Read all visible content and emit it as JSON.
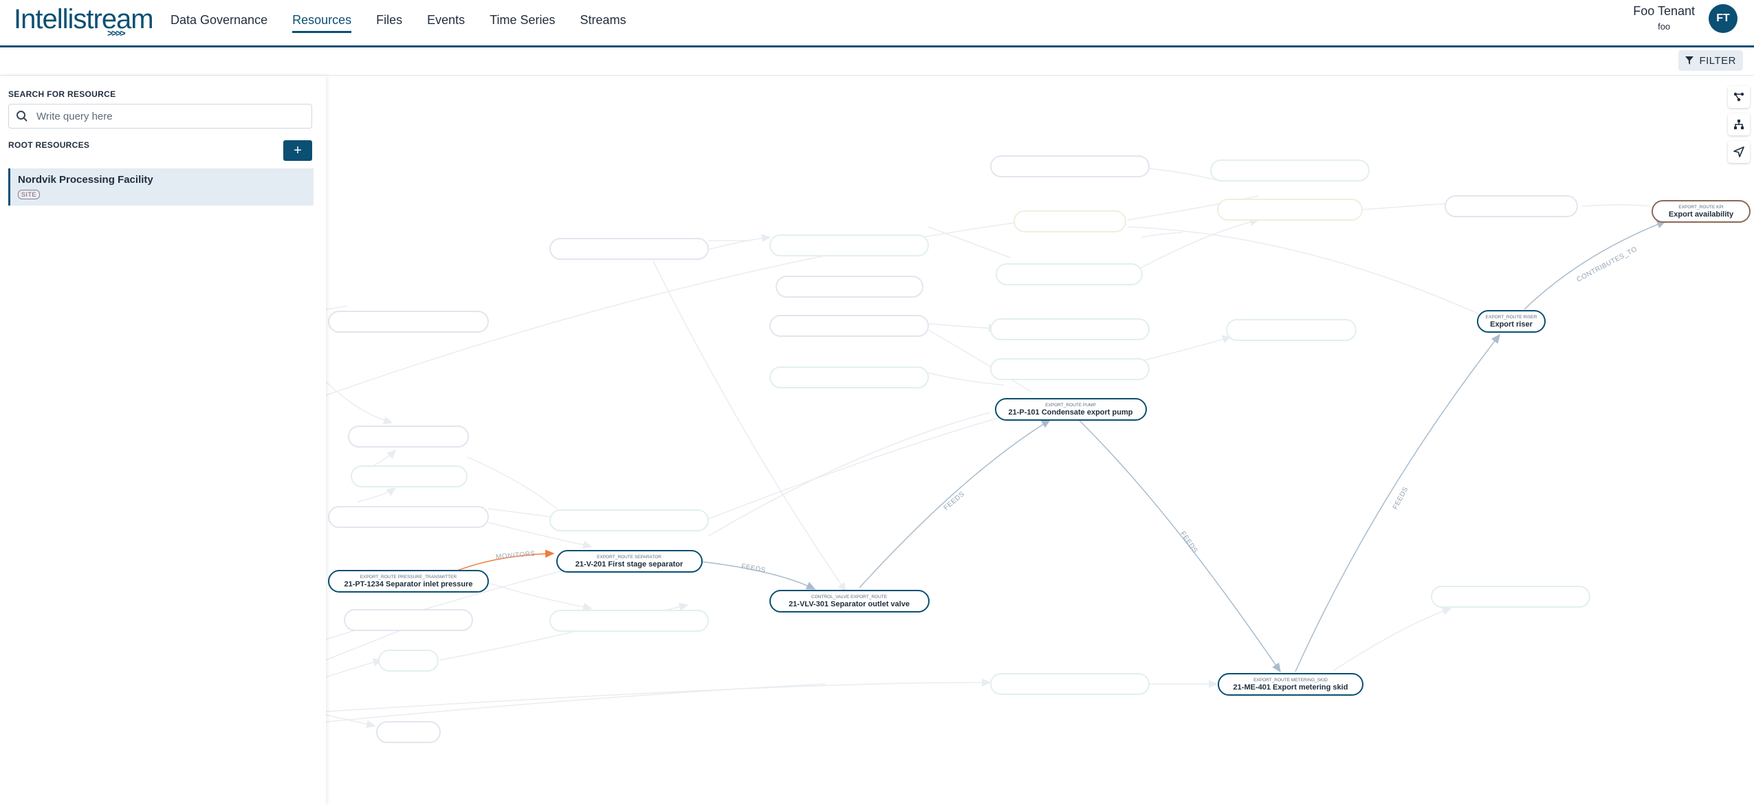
{
  "brand": {
    "name": "Intellistream",
    "arrows": ">>>>"
  },
  "nav": [
    {
      "label": "Data Governance",
      "active": false
    },
    {
      "label": "Resources",
      "active": true
    },
    {
      "label": "Files",
      "active": false
    },
    {
      "label": "Events",
      "active": false
    },
    {
      "label": "Time Series",
      "active": false
    },
    {
      "label": "Streams",
      "active": false
    }
  ],
  "tenant": {
    "name": "Foo Tenant",
    "sub": "foo",
    "initials": "FT"
  },
  "toolbar": {
    "filter_label": "FILTER",
    "filter_icon": "funnel-icon"
  },
  "sidebar": {
    "search_label": "SEARCH FOR RESOURCE",
    "search_placeholder": "Write query here",
    "root_label": "ROOT RESOURCES",
    "add_label": "+",
    "site": {
      "name": "Nordvik Processing Facility",
      "badge": "SITE"
    }
  },
  "graph": {
    "colors": {
      "node_border": "#0b4f73",
      "edge": "#a8bccd",
      "monitor_edge": "#f07e3f",
      "kpi_border": "#8a6a58",
      "faded_edge": "#e8edf2"
    },
    "tools": [
      "graph-layout-icon",
      "hierarchy-icon",
      "navigate-icon"
    ],
    "nodes": [
      {
        "id": "pt",
        "type": "EXPORT_ROUTE  PRESSURE_TRANSMITTER",
        "label": "21-PT-1234 Separator inlet pressure"
      },
      {
        "id": "sep",
        "type": "EXPORT_ROUTE  SEPARATOR",
        "label": "21-V-201 First stage separator"
      },
      {
        "id": "vlv",
        "type": "CONTROL_VALVE  EXPORT_ROUTE",
        "label": "21-VLV-301 Separator outlet valve"
      },
      {
        "id": "pump",
        "type": "EXPORT_ROUTE  PUMP",
        "label": "21-P-101 Condensate export pump"
      },
      {
        "id": "skid",
        "type": "EXPORT_ROUTE  METERING_SKID",
        "label": "21-ME-401 Export metering skid"
      },
      {
        "id": "riser",
        "type": "EXPORT_ROUTE  RISER",
        "label": "Export riser"
      },
      {
        "id": "kpi",
        "type": "EXPORT_ROUTE  KPI",
        "label": "Export availability"
      }
    ],
    "edges": [
      {
        "id": "e1",
        "label": "MONITORS"
      },
      {
        "id": "e2",
        "label": "FEEDS"
      },
      {
        "id": "e3",
        "label": "FEEDS"
      },
      {
        "id": "e4",
        "label": "FEEDS"
      },
      {
        "id": "e5",
        "label": "FEEDS"
      },
      {
        "id": "e6",
        "label": "CONTRIBUTES_TO"
      }
    ]
  }
}
